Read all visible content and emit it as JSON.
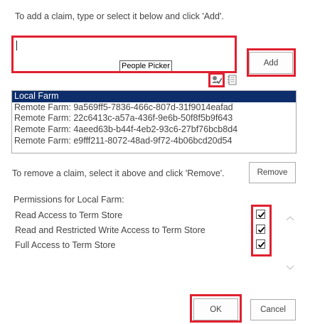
{
  "instructions": {
    "add": "To add a claim, type or select it below and click 'Add'.",
    "remove": "To remove a claim, select it above and click 'Remove'."
  },
  "picker": {
    "tooltip": "People Picker",
    "value": ""
  },
  "buttons": {
    "add": "Add",
    "remove": "Remove",
    "ok": "OK",
    "cancel": "Cancel"
  },
  "farms": [
    {
      "label": "Local Farm",
      "selected": true
    },
    {
      "label": "Remote Farm: 9a569ff5-7836-466c-807d-31f9014eafad",
      "selected": false
    },
    {
      "label": "Remote Farm: 22c6413c-a57a-436f-9e6b-50f8f5b9f643",
      "selected": false
    },
    {
      "label": "Remote Farm: 4aeed63b-b44f-4eb2-93c6-27bf76bcb8d4",
      "selected": false
    },
    {
      "label": "Remote Farm: e9fff211-8072-48ad-9f72-4b06bcd20d54",
      "selected": false
    }
  ],
  "permissions": {
    "title": "Permissions for Local Farm:",
    "items": [
      {
        "label": "Read Access to Term Store",
        "checked": true
      },
      {
        "label": "Read and Restricted Write Access to Term Store",
        "checked": true
      },
      {
        "label": "Full Access to Term Store",
        "checked": true
      }
    ]
  },
  "colors": {
    "highlight": "#e0202f",
    "selection": "#0d2d6b",
    "border": "#ababab"
  },
  "icons": [
    "check-names-icon",
    "browse-address-book-icon",
    "scroll-up-icon",
    "scroll-down-icon",
    "checkbox-checked-icon"
  ]
}
